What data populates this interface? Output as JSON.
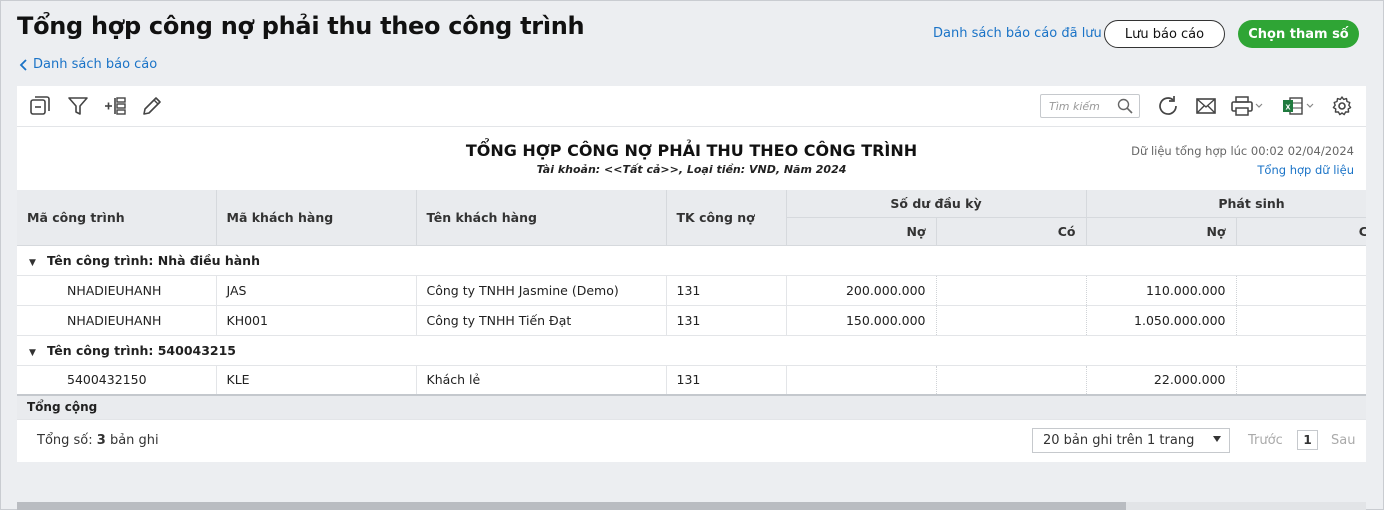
{
  "page": {
    "title": "Tổng hợp công nợ phải thu theo công trình",
    "back_label": "Danh sách báo cáo",
    "saved_reports_label": "Danh sách báo cáo đã lưu",
    "save_button": "Lưu báo cáo",
    "params_button": "Chọn tham số"
  },
  "toolbar": {
    "icons": [
      "collapse-icon",
      "filter-icon",
      "add-column-icon",
      "edit-icon",
      "refresh-icon",
      "email-icon",
      "print-icon",
      "excel-icon",
      "settings-icon"
    ],
    "search_placeholder": "Tìm kiếm"
  },
  "report": {
    "title": "TỔNG HỢP CÔNG NỢ PHẢI THU THEO CÔNG TRÌNH",
    "subtitle": "Tài khoản: <<Tất cả>>, Loại tiền: VND, Năm 2024",
    "data_time": "Dữ liệu tổng hợp lúc 00:02 02/04/2024",
    "refresh_label": "Tổng hợp dữ liệu"
  },
  "table": {
    "headers": {
      "project_code": "Mã công trình",
      "customer_code": "Mã khách hàng",
      "customer_name": "Tên khách hàng",
      "account": "TK công nợ",
      "opening_balance": "Số dư đầu kỳ",
      "arising": "Phát sinh",
      "debit": "Nợ",
      "credit": "Có"
    },
    "groups": [
      {
        "label": "Tên công trình: Nhà điều hành",
        "rows": [
          {
            "project_code": "NHADIEUHANH",
            "customer_code": "JAS",
            "customer_name": "Công ty TNHH Jasmine (Demo)",
            "account": "131",
            "open_debit": "200.000.000",
            "open_credit": "",
            "arise_debit": "110.000.000",
            "arise_credit": ""
          },
          {
            "project_code": "NHADIEUHANH",
            "customer_code": "KH001",
            "customer_name": "Công ty TNHH Tiến Đạt",
            "account": "131",
            "open_debit": "150.000.000",
            "open_credit": "",
            "arise_debit": "1.050.000.000",
            "arise_credit": ""
          }
        ]
      },
      {
        "label": "Tên công trình: 540043215",
        "rows": [
          {
            "project_code": "5400432150",
            "customer_code": "KLE",
            "customer_name": "Khách lẻ",
            "account": "131",
            "open_debit": "",
            "open_credit": "",
            "arise_debit": "22.000.000",
            "arise_credit": ""
          }
        ]
      }
    ],
    "total_label": "Tổng cộng"
  },
  "pager": {
    "total_prefix": "Tổng số: ",
    "total_count": "3",
    "total_suffix": " bản ghi",
    "page_size_label": "20 bản ghi trên 1 trang",
    "prev_label": "Trước",
    "current_page": "1",
    "next_label": "Sau"
  },
  "colors": {
    "accent_link": "#1a73c7",
    "primary_button": "#2fa535",
    "header_bg": "#e9ebee"
  }
}
